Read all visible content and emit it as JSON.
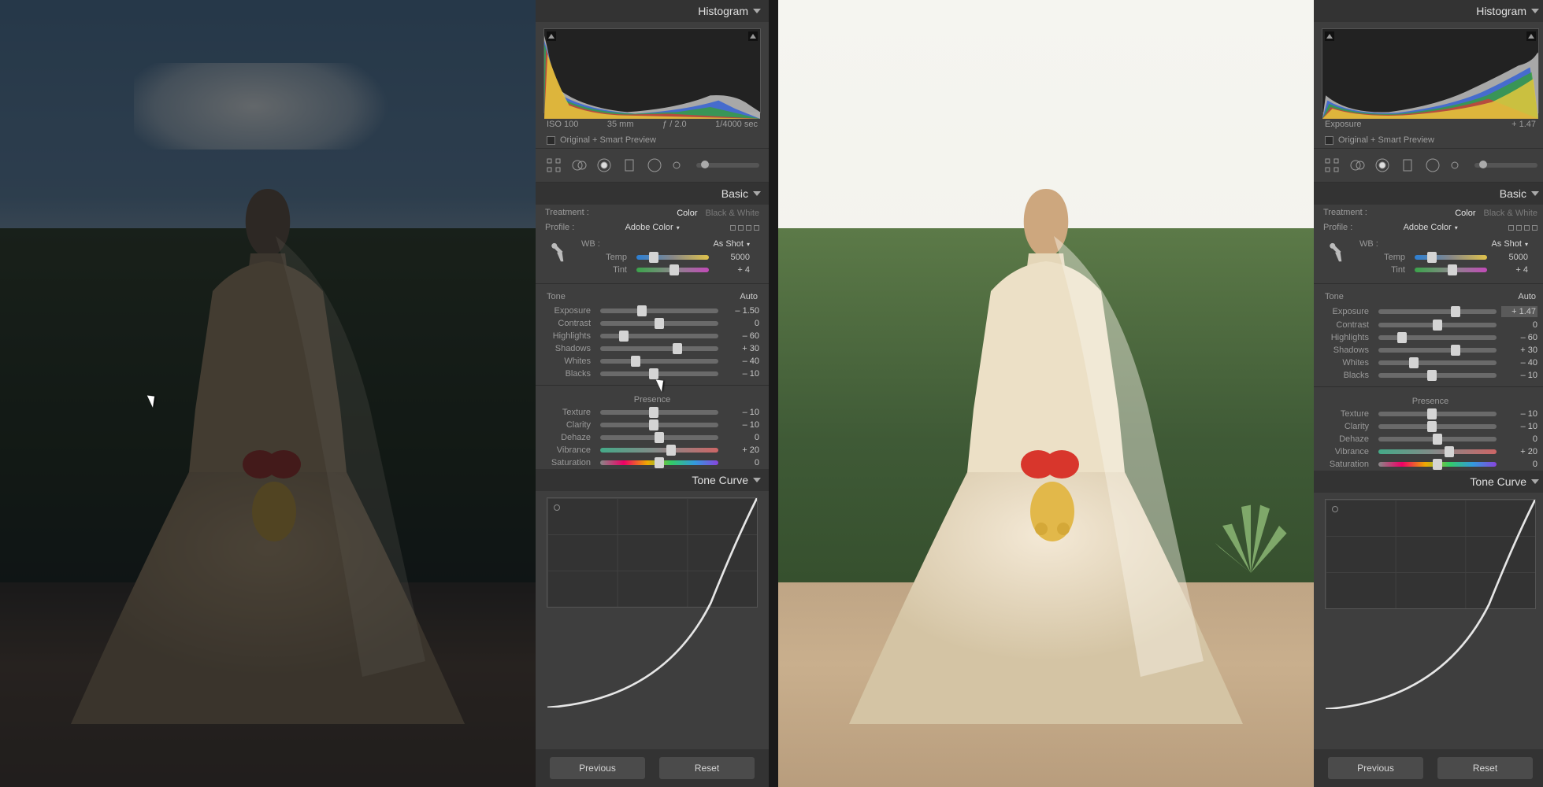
{
  "headers": {
    "histogram": "Histogram",
    "basic": "Basic",
    "toneCurve": "Tone Curve"
  },
  "previewLabel": "Original + Smart Preview",
  "treatment": {
    "label": "Treatment :",
    "color": "Color",
    "bw": "Black & White"
  },
  "profile": {
    "label": "Profile :",
    "value": "Adobe Color"
  },
  "wb": {
    "label": "WB :",
    "value": "As Shot"
  },
  "toneLabel": "Tone",
  "autoLabel": "Auto",
  "presenceLabel": "Presence",
  "buttons": {
    "previous": "Previous",
    "reset": "Reset"
  },
  "left": {
    "meta": {
      "iso": "ISO 100",
      "focal": "35 mm",
      "aperture": "ƒ / 2.0",
      "shutter": "1/4000 sec"
    },
    "temp": {
      "label": "Temp",
      "value": "5000",
      "pos": 24
    },
    "tint": {
      "label": "Tint",
      "value": "+ 4",
      "pos": 52
    },
    "exposure": {
      "label": "Exposure",
      "value": "– 1.50",
      "pos": 35
    },
    "contrast": {
      "label": "Contrast",
      "value": "0",
      "pos": 50
    },
    "highlights": {
      "label": "Highlights",
      "value": "– 60",
      "pos": 20
    },
    "shadows": {
      "label": "Shadows",
      "value": "+ 30",
      "pos": 65
    },
    "whites": {
      "label": "Whites",
      "value": "– 40",
      "pos": 30
    },
    "blacks": {
      "label": "Blacks",
      "value": "– 10",
      "pos": 45
    },
    "texture": {
      "label": "Texture",
      "value": "– 10",
      "pos": 45
    },
    "clarity": {
      "label": "Clarity",
      "value": "– 10",
      "pos": 45
    },
    "dehaze": {
      "label": "Dehaze",
      "value": "0",
      "pos": 50
    },
    "vibrance": {
      "label": "Vibrance",
      "value": "+ 20",
      "pos": 60
    },
    "saturation": {
      "label": "Saturation",
      "value": "0",
      "pos": 50
    }
  },
  "right": {
    "meta": {
      "field": "Exposure",
      "value": "+ 1.47"
    },
    "temp": {
      "label": "Temp",
      "value": "5000",
      "pos": 24
    },
    "tint": {
      "label": "Tint",
      "value": "+ 4",
      "pos": 52
    },
    "exposure": {
      "label": "Exposure",
      "value": "+ 1.47",
      "pos": 65,
      "selected": true
    },
    "contrast": {
      "label": "Contrast",
      "value": "0",
      "pos": 50
    },
    "highlights": {
      "label": "Highlights",
      "value": "– 60",
      "pos": 20
    },
    "shadows": {
      "label": "Shadows",
      "value": "+ 30",
      "pos": 65
    },
    "whites": {
      "label": "Whites",
      "value": "– 40",
      "pos": 30
    },
    "blacks": {
      "label": "Blacks",
      "value": "– 10",
      "pos": 45
    },
    "texture": {
      "label": "Texture",
      "value": "– 10",
      "pos": 45
    },
    "clarity": {
      "label": "Clarity",
      "value": "– 10",
      "pos": 45
    },
    "dehaze": {
      "label": "Dehaze",
      "value": "0",
      "pos": 50
    },
    "vibrance": {
      "label": "Vibrance",
      "value": "+ 20",
      "pos": 60
    },
    "saturation": {
      "label": "Saturation",
      "value": "0",
      "pos": 50
    }
  }
}
